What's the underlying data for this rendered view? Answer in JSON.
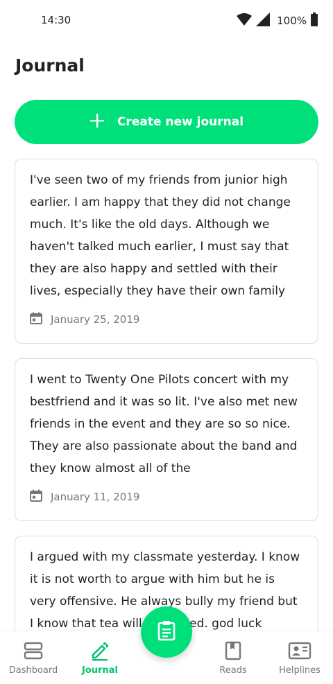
{
  "status_bar": {
    "time": "14:30",
    "battery": "100%"
  },
  "page": {
    "title": "Journal"
  },
  "create_button": {
    "label": "Create new journal"
  },
  "entries": [
    {
      "text": "I've seen two of my friends from junior high earlier. I am happy that they did not change much. It's like the old days. Although we haven't talked much earlier, I must say that they are also happy and settled with their lives, especially they have their own family",
      "date": "January 25, 2019"
    },
    {
      "text": "I went to Twenty One Pilots concert with my bestfriend and it was so lit. I've also met new friends in the event and they are so so nice. They are also passionate about the band and they know almost all of the",
      "date": "January 11, 2019"
    },
    {
      "text": "I argued with my classmate yesterday. I know it is not worth to argue with him but he is very offensive. He always bully my friend but I know that tea will be served. god luck",
      "date": ""
    }
  ],
  "bottom_nav": {
    "items": [
      {
        "label": "Dashboard",
        "icon": "dashboard-icon"
      },
      {
        "label": "Journal",
        "icon": "pencil-icon"
      },
      {
        "label": "Reads",
        "icon": "book-icon"
      },
      {
        "label": "Helplines",
        "icon": "contacts-icon"
      }
    ]
  },
  "fab": {
    "icon": "clipboard-icon"
  },
  "colors": {
    "accent": "#00e07a",
    "accent_text": "#00c26a",
    "muted": "#777777",
    "border": "#dcdcdc"
  }
}
